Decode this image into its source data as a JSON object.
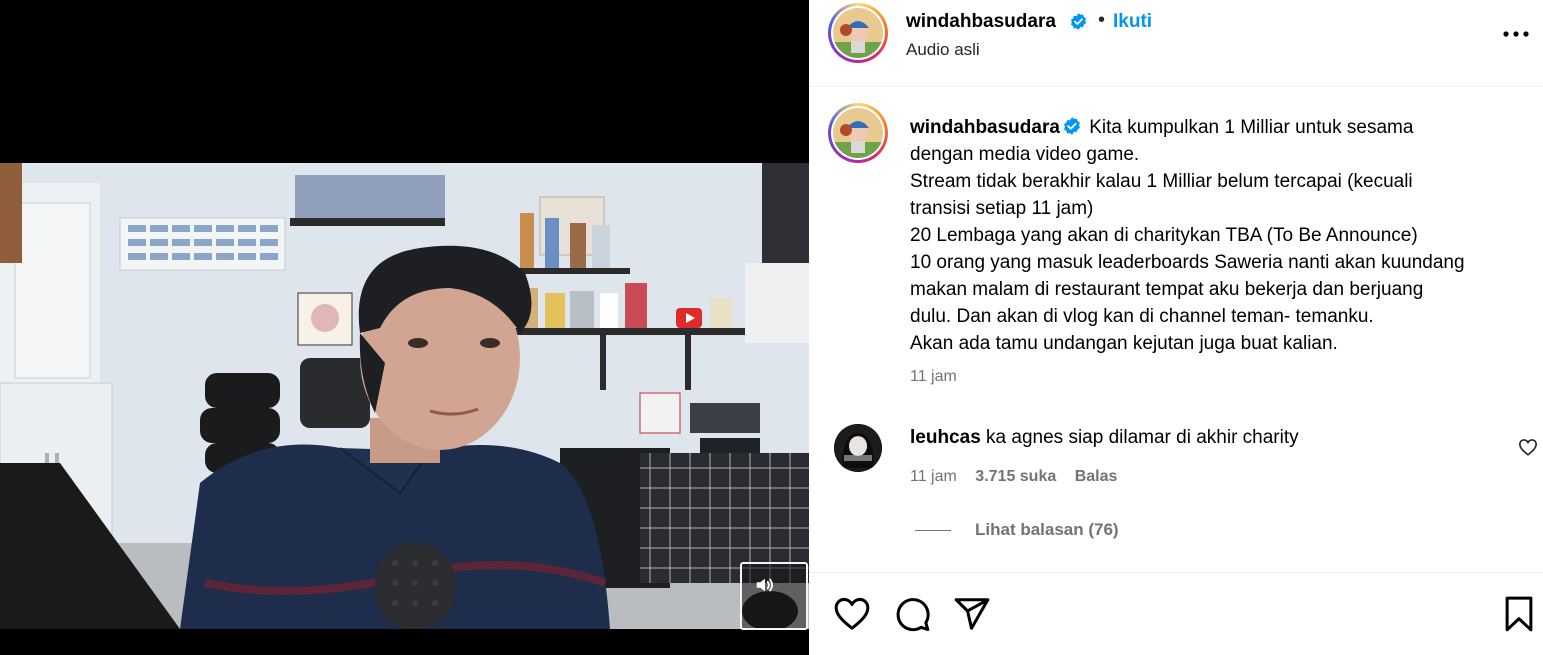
{
  "post": {
    "author": "windahbasudara",
    "follow_label": "Ikuti",
    "separator": "•",
    "audio_label": "Audio asli",
    "more_icon": "more-horizontal-icon"
  },
  "caption": {
    "username": "windahbasudara",
    "lines": [
      "Kita kumpulkan 1 Milliar untuk sesama",
      "dengan media video game.",
      "Stream tidak berakhir kalau 1 Milliar belum tercapai (kecuali",
      "transisi setiap 11 jam)",
      "20 Lembaga yang akan di charitykan TBA (To Be Announce)",
      "10 orang yang masuk leaderboards Saweria nanti akan kuundang",
      "makan malam di restaurant tempat aku bekerja dan berjuang",
      "dulu. Dan akan di vlog kan di channel teman- temanku.",
      "Akan ada tamu undangan kejutan juga buat kalian."
    ],
    "time": "11 jam"
  },
  "comment": {
    "username": "leuhcas",
    "text": "ka agnes siap dilamar di akhir charity",
    "time": "11 jam",
    "likes": "3.715 suka",
    "reply_label": "Balas"
  },
  "replies": {
    "label": "Lihat balasan (76)"
  },
  "actions": [
    "heart-icon",
    "comment-icon",
    "share-icon",
    "bookmark-icon"
  ],
  "colors": {
    "accent": "#0095f6",
    "verified": "#0095f6",
    "muted_text": "#737373"
  }
}
